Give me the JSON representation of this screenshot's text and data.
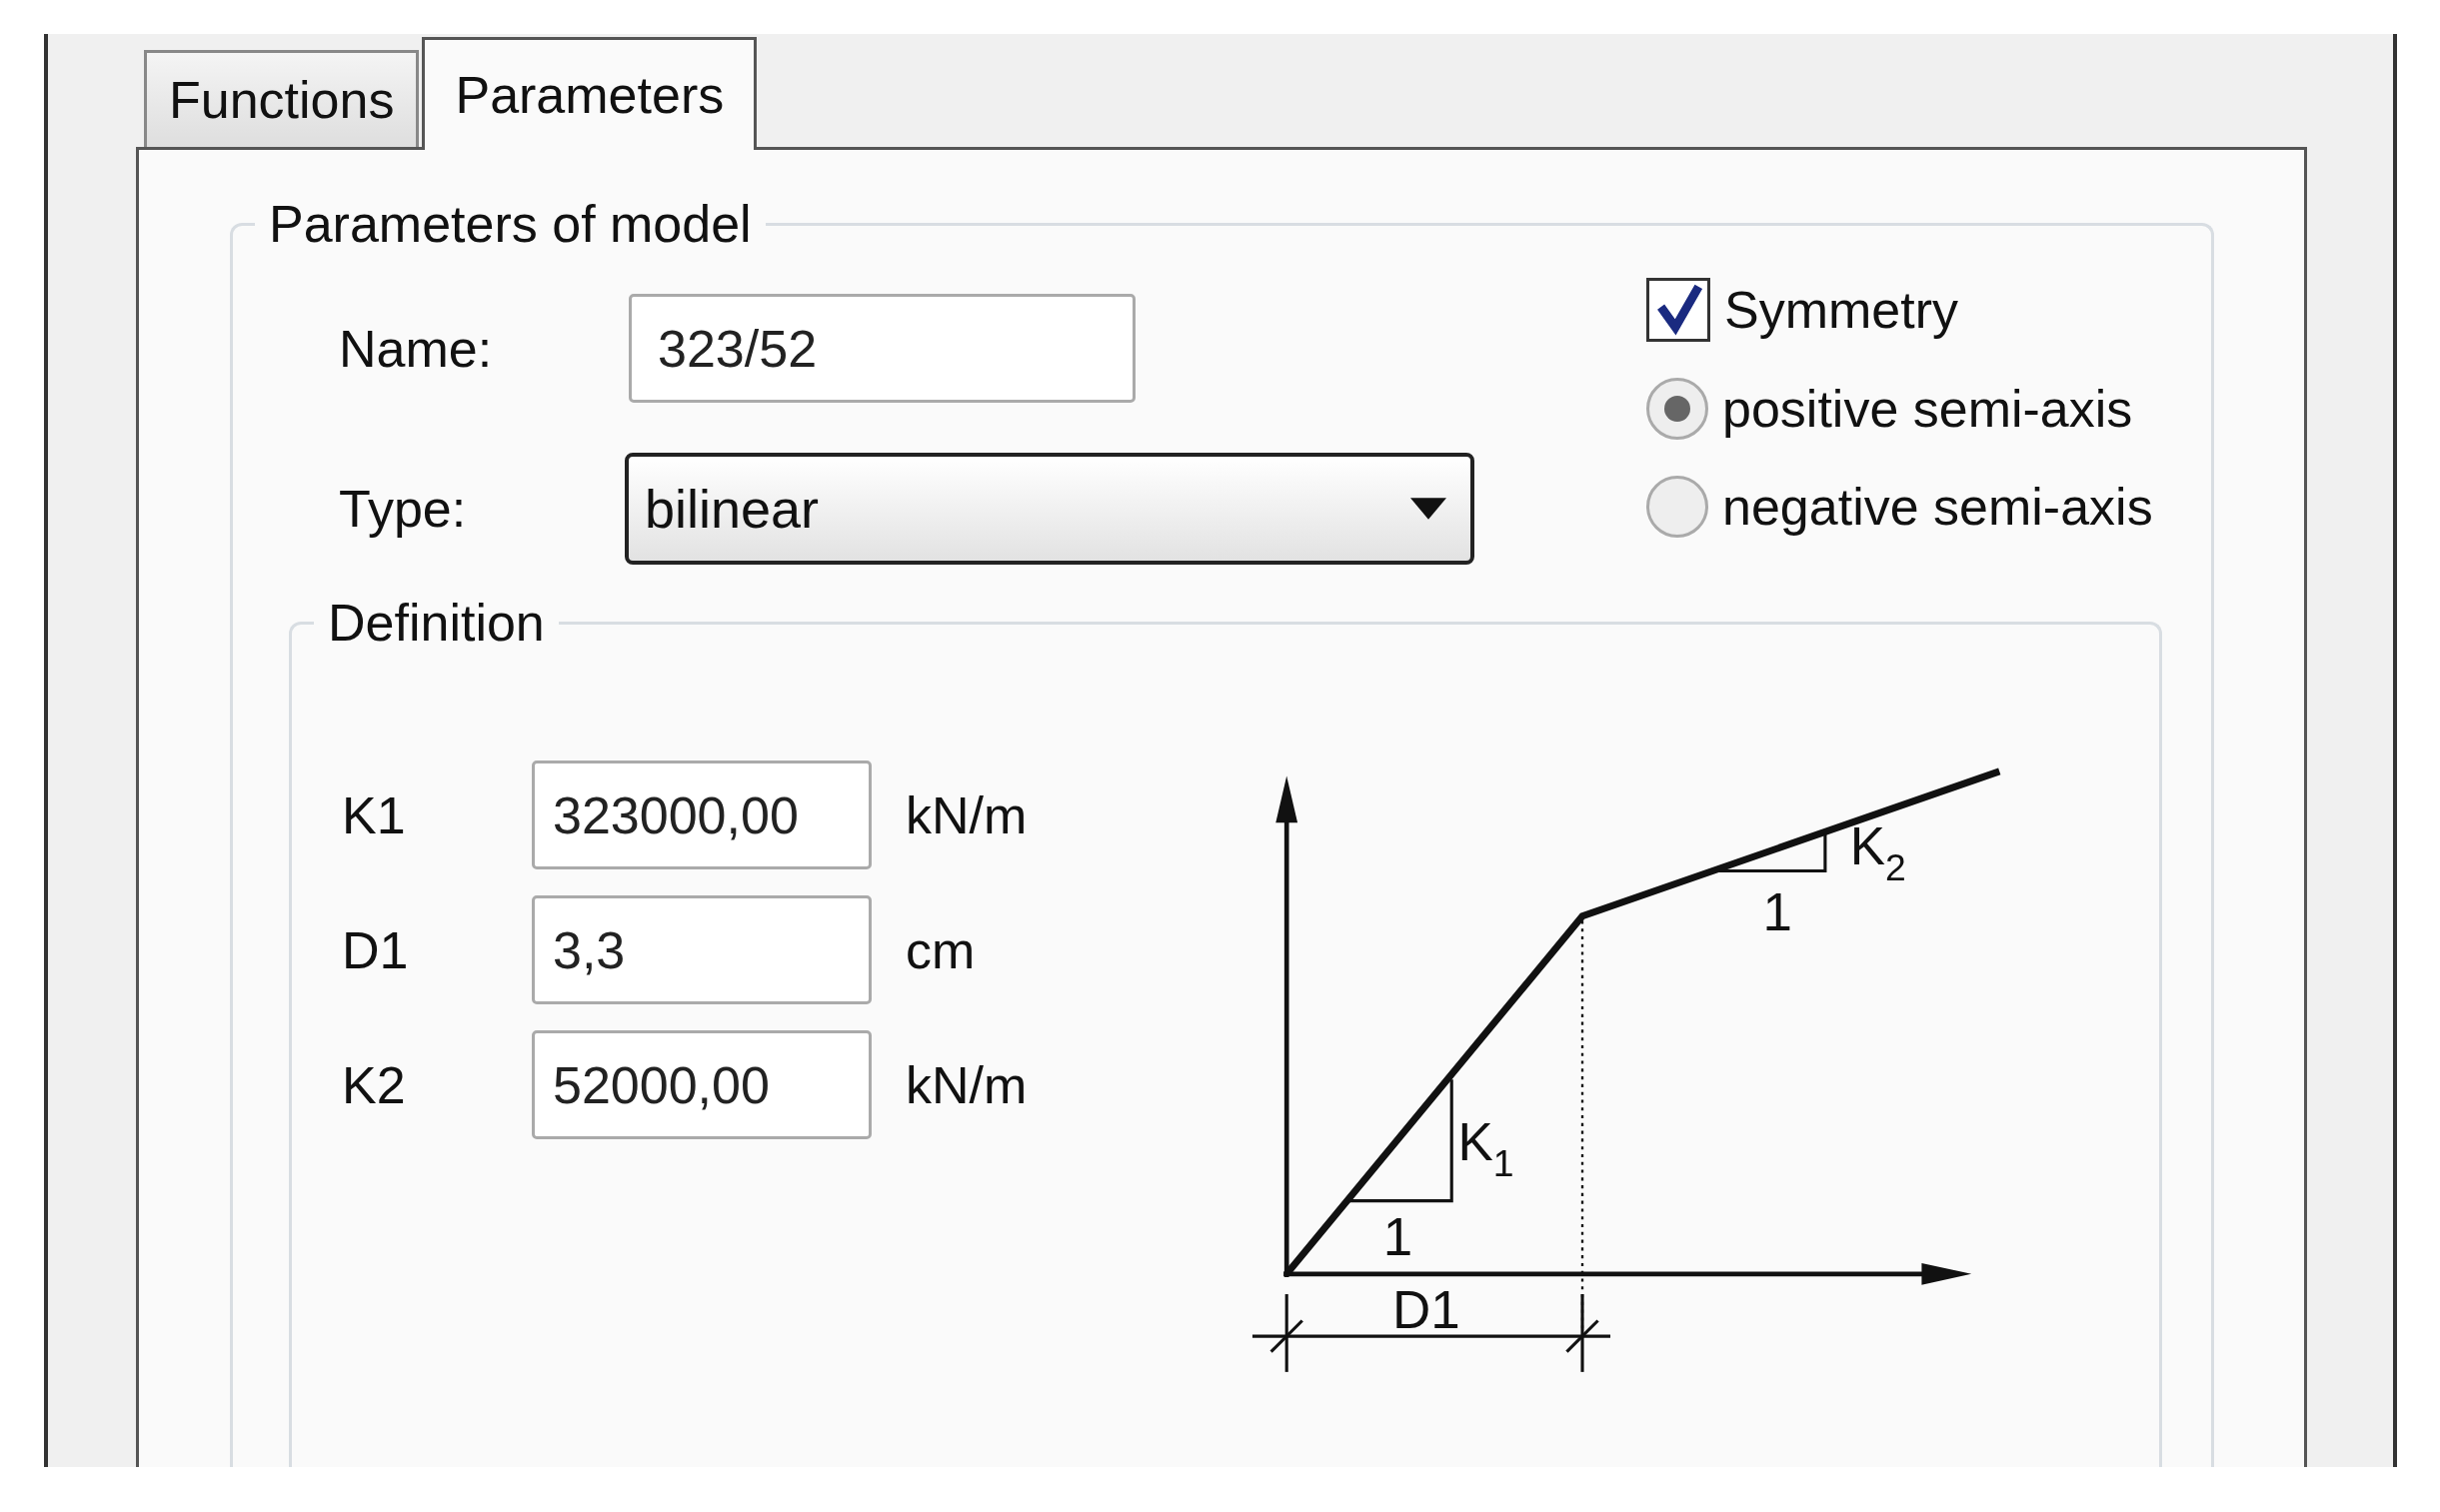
{
  "tabs": [
    {
      "label": "Functions",
      "selected": false
    },
    {
      "label": "Parameters",
      "selected": true
    }
  ],
  "model": {
    "title": "Parameters of model",
    "name": {
      "label": "Name:",
      "value": "323/52"
    },
    "type": {
      "label": "Type:",
      "value": "bilinear"
    },
    "symmetry": {
      "label": "Symmetry",
      "checked": true
    },
    "axis_options": [
      {
        "label": "positive semi-axis",
        "selected": true
      },
      {
        "label": "negative semi-axis",
        "selected": false
      }
    ],
    "definition": {
      "title": "Definition",
      "params": [
        {
          "label": "K1",
          "value": "323000,00",
          "unit": "kN/m"
        },
        {
          "label": "D1",
          "value": "3,3",
          "unit": "cm"
        },
        {
          "label": "K2",
          "value": "52000,00",
          "unit": "kN/m"
        }
      ],
      "diagram": {
        "slope_1": {
          "symbol": "K",
          "subscript": "1",
          "run": "1"
        },
        "slope_2": {
          "symbol": "K",
          "subscript": "2",
          "run": "1"
        },
        "span": "D1"
      }
    }
  }
}
